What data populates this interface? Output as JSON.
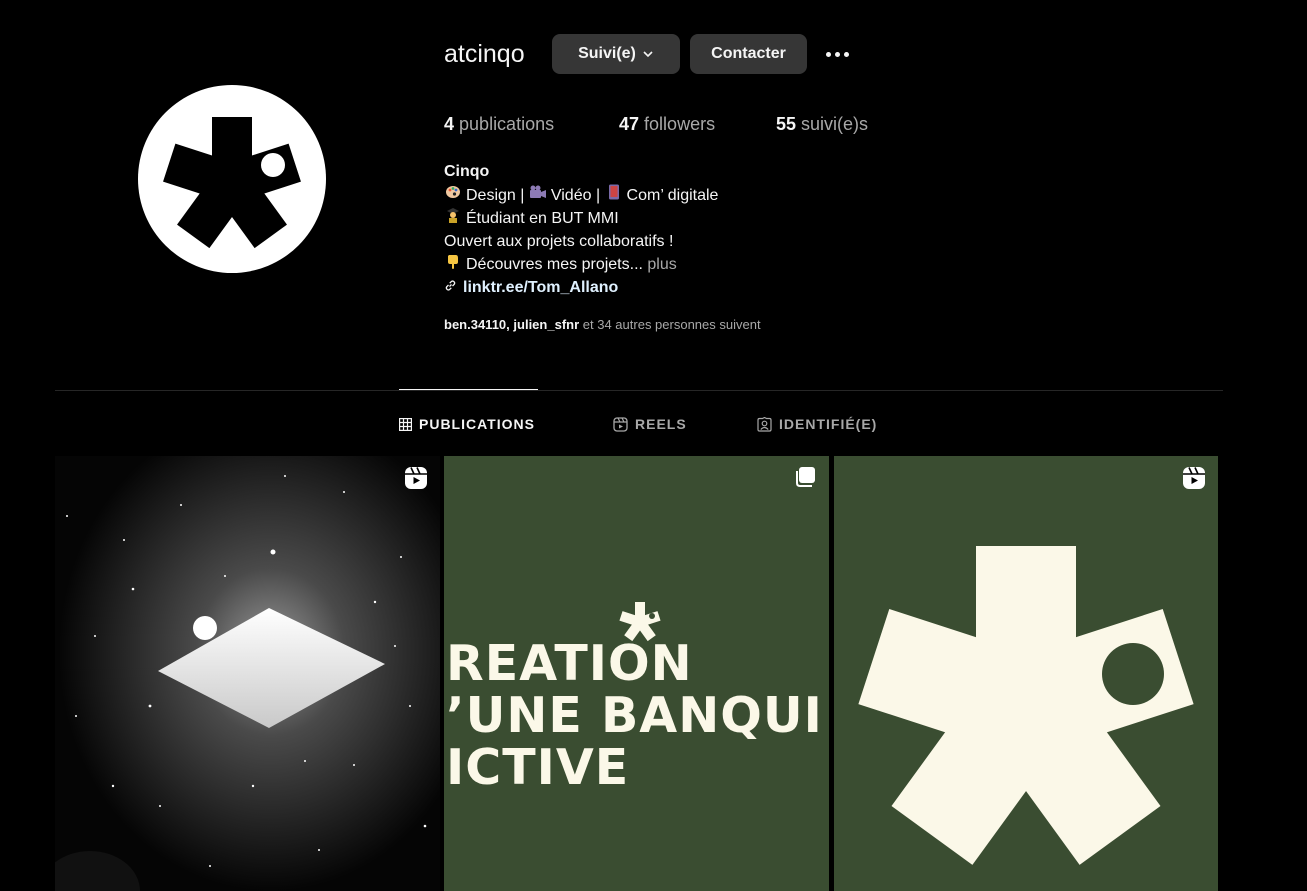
{
  "profile": {
    "username": "atcinqo",
    "follow_button": "Suivi(e)",
    "contact_button": "Contacter",
    "more_icon": "more-horizontal-icon",
    "stats": {
      "posts_count": "4",
      "posts_label": "publications",
      "followers_count": "47",
      "followers_label": "followers",
      "following_count": "55",
      "following_label": "suivi(e)s"
    },
    "bio": {
      "name": "Cinqo",
      "line1_text": "Design |",
      "line1_text2": "Vidéo |",
      "line1_text3": "Com’ digitale",
      "line2_text": "Étudiant en BUT MMI",
      "line3_text": "Ouvert aux projets collaboratifs !",
      "line4_text": "Découvres mes projets...",
      "line4_more": "plus",
      "link": "linktr.ee/Tom_Allano"
    },
    "followed_by": {
      "user1": "ben.34110",
      "separator": ",",
      "user2": "julien_sfnr",
      "suffix": "et 34 autres personnes suivent"
    }
  },
  "tabs": [
    {
      "label": "PUBLICATIONS",
      "icon": "grid-icon",
      "active": true
    },
    {
      "label": "REELS",
      "icon": "reels-icon",
      "active": false
    },
    {
      "label": "IDENTIFIÉ(E)",
      "icon": "tagged-icon",
      "active": false
    }
  ],
  "posts": [
    {
      "type": "reel",
      "icon": "reel-icon"
    },
    {
      "type": "carousel",
      "icon": "carousel-icon",
      "text_lines": [
        "REATION",
        "’UNE BANQUI",
        "ICTIVE"
      ]
    },
    {
      "type": "reel",
      "icon": "reel-icon"
    }
  ],
  "colors": {
    "background": "#000000",
    "button_bg": "#363636",
    "secondary_text": "#a8a8a8",
    "post_green": "#3a4d31",
    "post_cream": "#fbf8e8"
  }
}
